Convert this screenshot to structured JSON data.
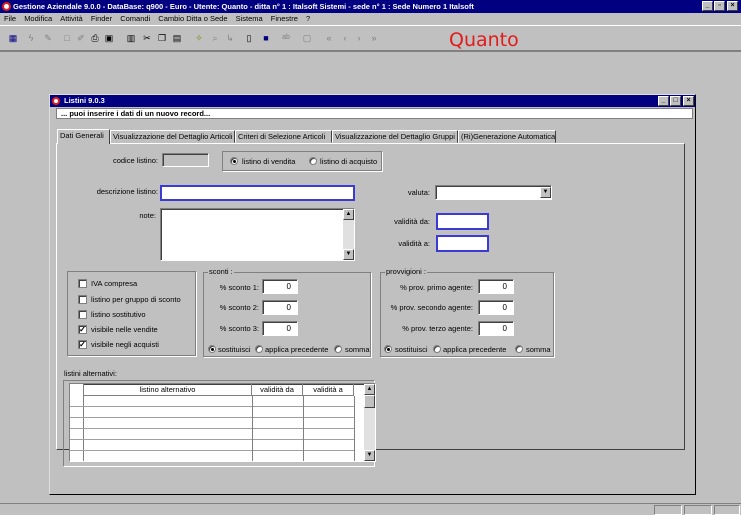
{
  "app": {
    "title": "Gestione Aziendale 9.0.0 - DataBase: q900 - Euro - Utente: Quanto - ditta n° 1 : Italsoft Sistemi - sede n° 1 : Sede Numero 1 Italsoft",
    "logo_text": "Quanto"
  },
  "menu": [
    "File",
    "Modifica",
    "Attività",
    "Finder",
    "Comandi",
    "Cambio Ditta o Sede",
    "Sistema",
    "Finestre",
    "?"
  ],
  "window": {
    "title": "Listini 9.0.3",
    "message": "... puoi inserire i dati di un nuovo record..."
  },
  "tabs": [
    "Dati Generali",
    "Visualizzazione del Dettaglio Articoli",
    "Criteri di Selezione Articoli",
    "Visualizzazione del Dettaglio Gruppi",
    "(Ri)Generazione Automatica"
  ],
  "form": {
    "codice_label": "codice listino:",
    "codice_value": "",
    "radio_vendita": "listino di vendita",
    "radio_acquisto": "listino di acquisto",
    "descrizione_label": "descrizione listino:",
    "descrizione_value": "",
    "note_label": "note:",
    "valuta_label": "valuta:",
    "valuta_value": "",
    "validita_da_label": "validità da:",
    "validita_a_label": "validità a:"
  },
  "checkboxes": [
    {
      "label": "IVA compresa",
      "checked": false
    },
    {
      "label": "listino per gruppo di sconto",
      "checked": false
    },
    {
      "label": "listino sostitutivo",
      "checked": false
    },
    {
      "label": "visibile nelle vendite",
      "checked": true
    },
    {
      "label": "visibile negli acquisti",
      "checked": true
    }
  ],
  "sconti": {
    "title": "sconti :",
    "rows": [
      {
        "label": "% sconto 1:",
        "value": "0"
      },
      {
        "label": "% sconto 2:",
        "value": "0"
      },
      {
        "label": "% sconto 3:",
        "value": "0"
      }
    ],
    "opt_sostituisci": "sostituisci",
    "opt_precedente": "applica precedente",
    "opt_somma": "somma"
  },
  "provvigioni": {
    "title": "provvigioni :",
    "rows": [
      {
        "label": "% prov. primo agente:",
        "value": "0"
      },
      {
        "label": "% prov. secondo agente:",
        "value": "0"
      },
      {
        "label": "% prov. terzo agente:",
        "value": "0"
      }
    ],
    "opt_sostituisci": "sostituisci",
    "opt_precedente": "applica precedente",
    "opt_somma": "somma"
  },
  "alternativi": {
    "title": "listini alternativi:",
    "columns": [
      "listino alternativo",
      "validità da",
      "validità a"
    ]
  }
}
